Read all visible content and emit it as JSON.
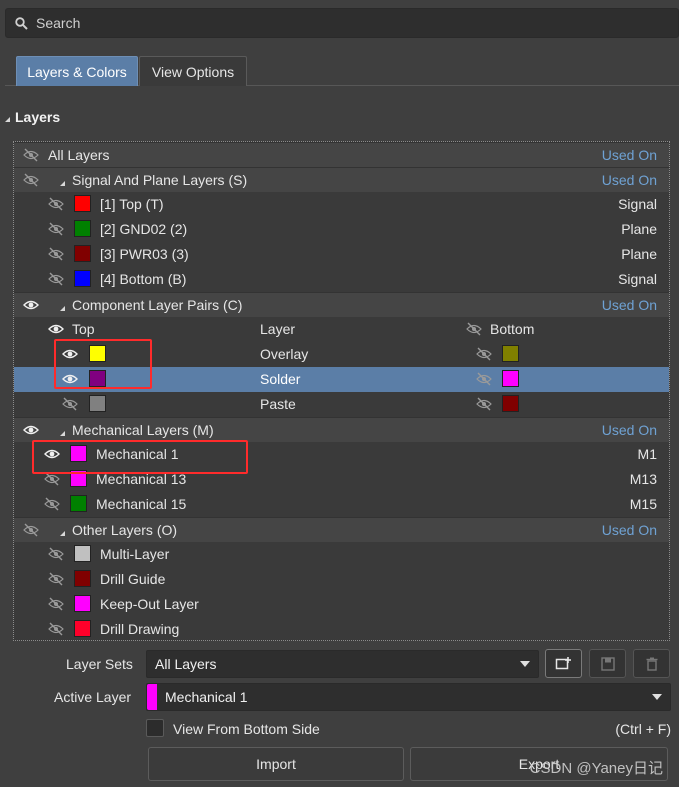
{
  "search": {
    "placeholder": "Search",
    "icon": "search-icon"
  },
  "tabs": [
    {
      "label": "Layers & Colors",
      "active": true
    },
    {
      "label": "View Options",
      "active": false
    }
  ],
  "section": {
    "title": "Layers"
  },
  "layers": {
    "all": {
      "label": "All Layers",
      "used_on": "Used On"
    },
    "signal_group": {
      "label": "Signal And Plane Layers (S)",
      "used_on": "Used On",
      "items": [
        {
          "name": "[1] Top (T)",
          "type": "Signal",
          "color": "#ff0000"
        },
        {
          "name": "[2] GND02 (2)",
          "type": "Plane",
          "color": "#008000"
        },
        {
          "name": "[3] PWR03 (3)",
          "type": "Plane",
          "color": "#800000"
        },
        {
          "name": "[4] Bottom (B)",
          "type": "Signal",
          "color": "#0000ff"
        }
      ]
    },
    "component_group": {
      "label": "Component Layer Pairs (C)",
      "used_on": "Used On",
      "headers": {
        "top": "Top",
        "layer": "Layer",
        "bottom": "Bottom"
      },
      "items": [
        {
          "layer": "Overlay",
          "top_color": "#ffff00",
          "bottom_color": "#808000",
          "top_visible": true,
          "selected": false
        },
        {
          "layer": "Solder",
          "top_color": "#800080",
          "bottom_color": "#ff00ff",
          "top_visible": true,
          "selected": true
        },
        {
          "layer": "Paste",
          "top_color": "#808080",
          "bottom_color": "#800000",
          "top_visible": false,
          "selected": false
        }
      ]
    },
    "mechanical_group": {
      "label": "Mechanical Layers (M)",
      "used_on": "Used On",
      "items": [
        {
          "name": "Mechanical 1",
          "code": "M1",
          "color": "#ff00ff",
          "visible": true
        },
        {
          "name": "Mechanical 13",
          "code": "M13",
          "color": "#ff00ff",
          "visible": false
        },
        {
          "name": "Mechanical 15",
          "code": "M15",
          "color": "#008000",
          "visible": false
        }
      ]
    },
    "other_group": {
      "label": "Other Layers (O)",
      "used_on": "Used On",
      "items": [
        {
          "name": "Multi-Layer",
          "color": "#c0c0c0"
        },
        {
          "name": "Drill Guide",
          "color": "#800000"
        },
        {
          "name": "Keep-Out Layer",
          "color": "#ff00ff"
        },
        {
          "name": "Drill Drawing",
          "color": "#ff002a"
        }
      ]
    }
  },
  "controls": {
    "layer_sets_label": "Layer Sets",
    "layer_sets_value": "All Layers",
    "active_layer_label": "Active Layer",
    "active_layer_value": "Mechanical 1",
    "active_layer_color": "#ff00ff",
    "view_bottom_label": "View From Bottom Side",
    "view_bottom_shortcut": "(Ctrl + F)",
    "view_bottom_checked": false,
    "import_label": "Import",
    "export_label": "Export"
  },
  "watermark": "CSDN @Yaney日记",
  "colors": {
    "accent": "#5b7ea7",
    "used_on": "#6fa2d4",
    "highlight": "#ff2b2b"
  }
}
